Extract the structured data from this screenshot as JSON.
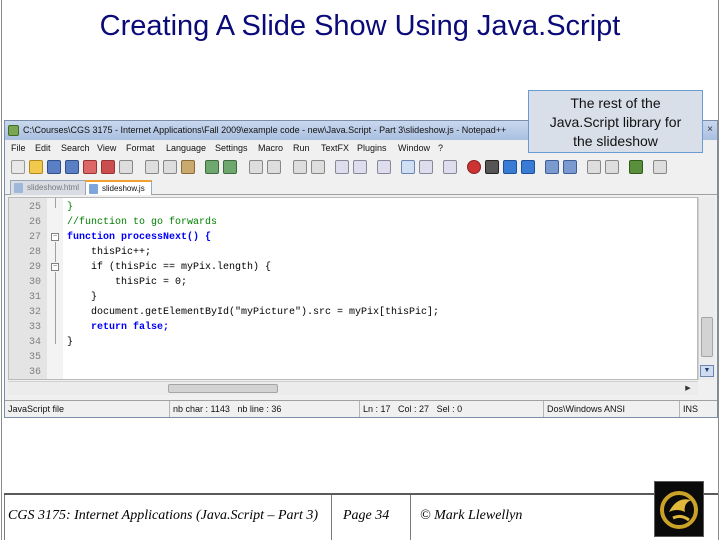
{
  "slide": {
    "title": "Creating A Slide Show Using Java.Script",
    "callout": [
      "The rest of the",
      "Java.Script library for",
      "the slideshow"
    ]
  },
  "window": {
    "title": "C:\\Courses\\CGS 3175 - Internet Applications\\Fall 2009\\example code - new\\Java.Script - Part 3\\slideshow.js - Notepad++",
    "close": "×"
  },
  "menu": [
    "File",
    "Edit",
    "Search",
    "View",
    "Format",
    "Language",
    "Settings",
    "Macro",
    "Run",
    "TextFX",
    "Plugins",
    "Window",
    "?"
  ],
  "tabs": [
    {
      "label": "slideshow.html",
      "active": false
    },
    {
      "label": "slideshow.js",
      "active": true
    }
  ],
  "code_lines": [
    {
      "num": "25",
      "text": "}"
    },
    {
      "num": "26",
      "text": "//function to go forwards"
    },
    {
      "num": "27",
      "text": "function processNext() {"
    },
    {
      "num": "28",
      "text": "    thisPic++;"
    },
    {
      "num": "29",
      "text": "    if (thisPic == myPix.length) {"
    },
    {
      "num": "30",
      "text": "        thisPic = 0;"
    },
    {
      "num": "31",
      "text": "    }"
    },
    {
      "num": "32",
      "text": "    document.getElementById(\"myPicture\").src = myPix[thisPic];"
    },
    {
      "num": "33",
      "text": "    return false;"
    },
    {
      "num": "34",
      "text": "}"
    },
    {
      "num": "35",
      "text": ""
    },
    {
      "num": "36",
      "text": ""
    }
  ],
  "status": {
    "file_type": "JavaScript file",
    "nb_char": "nb char : 1143",
    "nb_line": "nb line : 36",
    "ln": "Ln : 17",
    "col": "Col : 27",
    "sel": "Sel : 0",
    "eol": "Dos\\Windows ANSI",
    "mode": "INS"
  },
  "footer": {
    "course": "CGS 3175: Internet Applications (Java.Script – Part 3)",
    "page": "Page 34",
    "author": "© Mark Llewellyn"
  },
  "icons": {
    "app": "notepadpp-icon",
    "logo": "ucf-pegasus-logo-icon"
  },
  "colors": {
    "title": "#0a0a78",
    "keyword": "#0000ff",
    "comment": "#008000",
    "string": "#808080",
    "number": "#ff0000",
    "callout_bg": "#d8dfe8",
    "logo_gold": "#c9a227"
  }
}
